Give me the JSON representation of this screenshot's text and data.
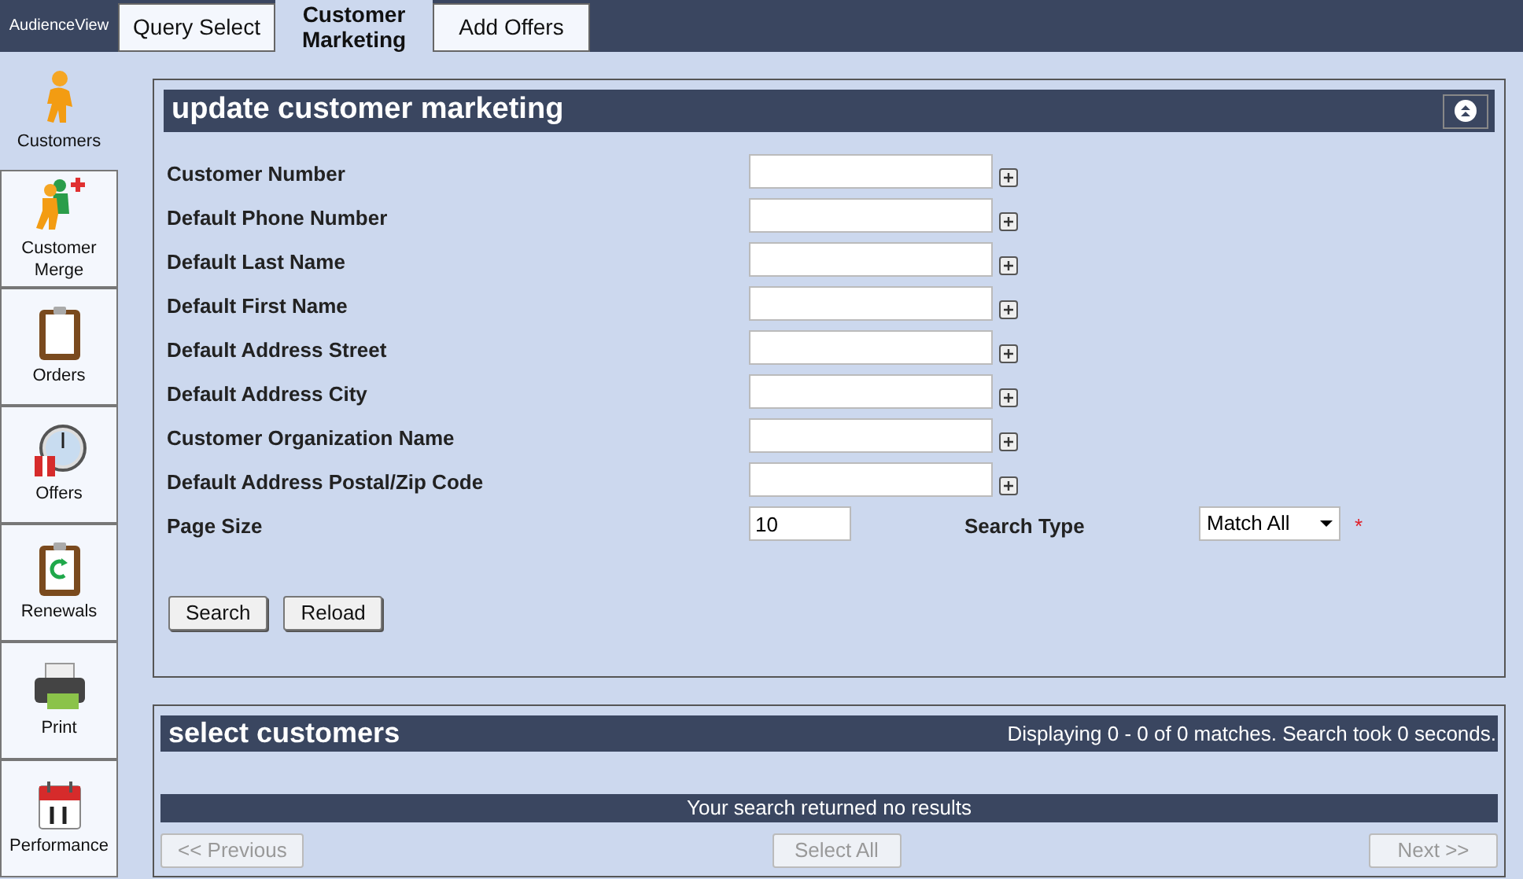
{
  "app_name": "AudienceView",
  "tabs": [
    {
      "label": "Query Select",
      "selected": false
    },
    {
      "label": "Customer Marketing",
      "selected": true
    },
    {
      "label": "Add Offers",
      "selected": false
    }
  ],
  "sidebar": {
    "items": [
      {
        "label": "Customers",
        "selected": true
      },
      {
        "label": "Customer Merge",
        "selected": false
      },
      {
        "label": "Orders",
        "selected": false
      },
      {
        "label": "Offers",
        "selected": false
      },
      {
        "label": "Renewals",
        "selected": false
      },
      {
        "label": "Print",
        "selected": false
      },
      {
        "label": "Performance",
        "selected": false
      }
    ]
  },
  "update_panel": {
    "title": "update customer marketing",
    "fields": [
      {
        "label": "Customer Number"
      },
      {
        "label": "Default Phone Number"
      },
      {
        "label": "Default Last Name"
      },
      {
        "label": "Default First Name"
      },
      {
        "label": "Default Address Street"
      },
      {
        "label": "Default Address City"
      },
      {
        "label": "Customer Organization Name"
      },
      {
        "label": "Default Address Postal/Zip Code"
      }
    ],
    "page_size": {
      "label": "Page Size",
      "value": "10"
    },
    "search_type": {
      "label": "Search Type",
      "value": "Match All",
      "required": true,
      "required_mark": "*"
    },
    "buttons": [
      {
        "label": "Search",
        "disabled": false
      },
      {
        "label": "Reload",
        "disabled": false
      }
    ]
  },
  "results_panel": {
    "title": "select customers",
    "summary": "Displaying 0 - 0 of 0 matches. Search took 0 seconds.",
    "message": "Your search returned no results",
    "buttons": [
      {
        "label": "<< Previous",
        "disabled": true
      },
      {
        "label": "Select All",
        "disabled": true
      },
      {
        "label": "Next >>",
        "disabled": true
      }
    ]
  }
}
